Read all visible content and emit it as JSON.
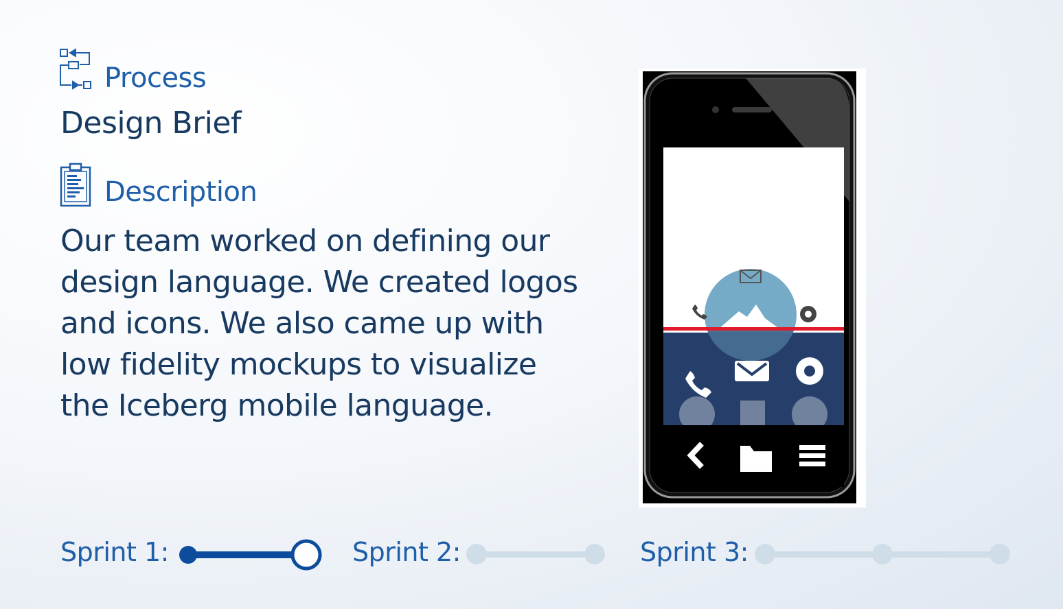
{
  "process": {
    "label": "Process",
    "icon": "process-flow-icon"
  },
  "title": "Design Brief",
  "description": {
    "label": "Description",
    "icon": "clipboard-icon",
    "lines": [
      "Our team worked on defining our",
      "design language.  We created logos",
      "and icons. We also came up with",
      "low fidelity mockups to visualize",
      "the Iceberg mobile language."
    ]
  },
  "mockup": {
    "menu_icons": [
      "phone-icon",
      "mail-icon",
      "gear-icon",
      "check-icon",
      "calendar-icon",
      "info-icon"
    ],
    "nav_icons": [
      "back-chevron-icon",
      "folder-icon",
      "hamburger-menu-icon"
    ],
    "colors": {
      "menu_bg": "#263f6a",
      "accent_line": "#e11b2b",
      "logo_circle": "#6ea6c3"
    }
  },
  "sprints": [
    {
      "label": "Sprint 1:",
      "progress": 1.0,
      "state": "active"
    },
    {
      "label": "Sprint 2:",
      "progress": 0,
      "state": "inactive"
    },
    {
      "label": "Sprint 3:",
      "progress": 0,
      "state": "inactive"
    }
  ],
  "colors": {
    "heading": "#1f5ea8",
    "text": "#183a60",
    "track_active": "#0d4c9c",
    "track_inactive": "#cfdde8"
  }
}
